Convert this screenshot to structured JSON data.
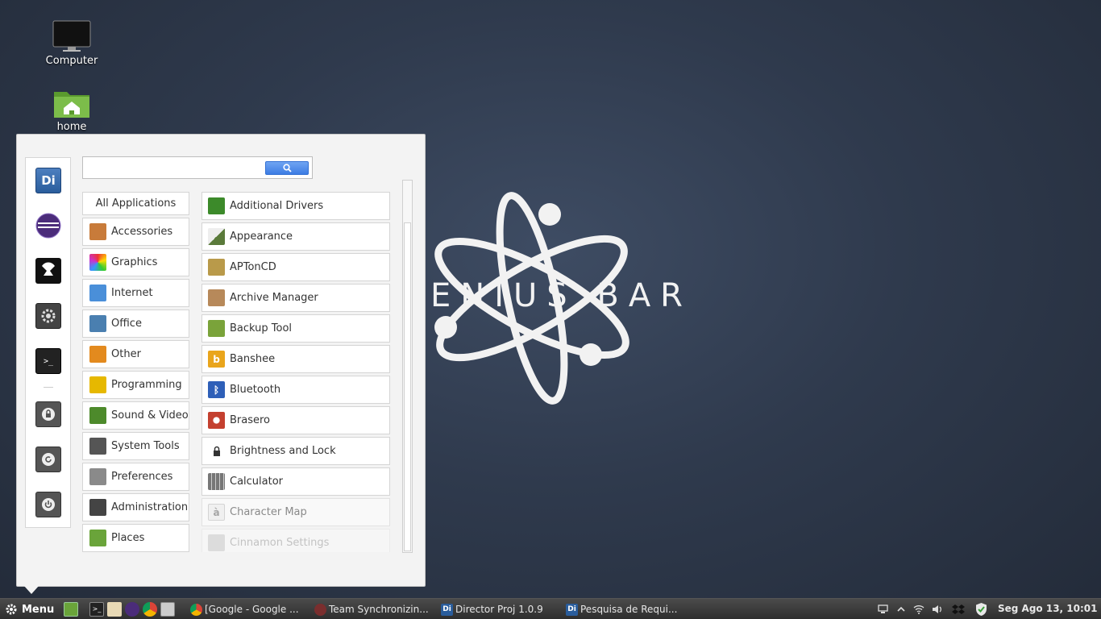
{
  "desktop": {
    "icons": [
      {
        "label": "Computer"
      },
      {
        "label": "home"
      }
    ],
    "wallpaper_text": "ENIUS BAR"
  },
  "menu": {
    "search": {
      "value": "",
      "placeholder": ""
    },
    "favorites": [
      "di-icon",
      "eclipse-icon",
      "inkscape-icon",
      "system-settings-icon",
      "terminal-icon",
      "lock-screen-icon",
      "logout-icon",
      "shutdown-icon"
    ],
    "categories": [
      {
        "label": "All Applications"
      },
      {
        "label": "Accessories",
        "icon": "accessories-icon",
        "color": "#c87b3a"
      },
      {
        "label": "Graphics",
        "icon": "graphics-icon",
        "color": "#d2409e"
      },
      {
        "label": "Internet",
        "icon": "internet-icon",
        "color": "#4a8fd9"
      },
      {
        "label": "Office",
        "icon": "office-icon",
        "color": "#4a7fb0"
      },
      {
        "label": "Other",
        "icon": "other-icon",
        "color": "#e38a1e"
      },
      {
        "label": "Programming",
        "icon": "programming-icon",
        "color": "#e6b800"
      },
      {
        "label": "Sound & Video",
        "icon": "sound-video-icon",
        "color": "#4d8a2b"
      },
      {
        "label": "System Tools",
        "icon": "system-tools-icon",
        "color": "#555555"
      },
      {
        "label": "Preferences",
        "icon": "preferences-icon",
        "color": "#8a8a8a"
      },
      {
        "label": "Administration",
        "icon": "administration-icon",
        "color": "#444444"
      },
      {
        "label": "Places",
        "icon": "folder-icon",
        "color": "#6aa43a"
      }
    ],
    "applications": [
      {
        "label": "Additional Drivers",
        "icon": "chip-icon",
        "color": "#3c8a2a"
      },
      {
        "label": "Appearance",
        "icon": "appearance-icon",
        "color": "#5a7a3a"
      },
      {
        "label": "APTonCD",
        "icon": "aptoncd-icon",
        "color": "#b99a4a"
      },
      {
        "label": "Archive Manager",
        "icon": "archive-icon",
        "color": "#b7895a"
      },
      {
        "label": "Backup Tool",
        "icon": "backup-icon",
        "color": "#7aa33a"
      },
      {
        "label": "Banshee",
        "icon": "banshee-icon",
        "color": "#e9a51c"
      },
      {
        "label": "Bluetooth",
        "icon": "bluetooth-icon",
        "color": "#2e5fb8"
      },
      {
        "label": "Brasero",
        "icon": "brasero-icon",
        "color": "#c4402f"
      },
      {
        "label": "Brightness and Lock",
        "icon": "lock-icon",
        "color": "#333333"
      },
      {
        "label": "Calculator",
        "icon": "calculator-icon",
        "color": "#777777"
      },
      {
        "label": "Character Map",
        "icon": "character-map-icon",
        "color": "#bbbbbb"
      },
      {
        "label": "Cinnamon Settings",
        "icon": "settings-icon",
        "color": "#999999"
      }
    ]
  },
  "taskbar": {
    "menu_label": "Menu",
    "windows": [
      {
        "label": "[Google - Google ...",
        "icon": "chrome-icon"
      },
      {
        "label": "Team Synchronizin...",
        "icon": "eclipse-icon"
      },
      {
        "label": "Director Proj 1.0.9",
        "icon": "di-icon"
      },
      {
        "label": "Pesquisa de Requi...",
        "icon": "di-icon"
      }
    ],
    "clock": "Seg Ago 13, 10:01"
  }
}
